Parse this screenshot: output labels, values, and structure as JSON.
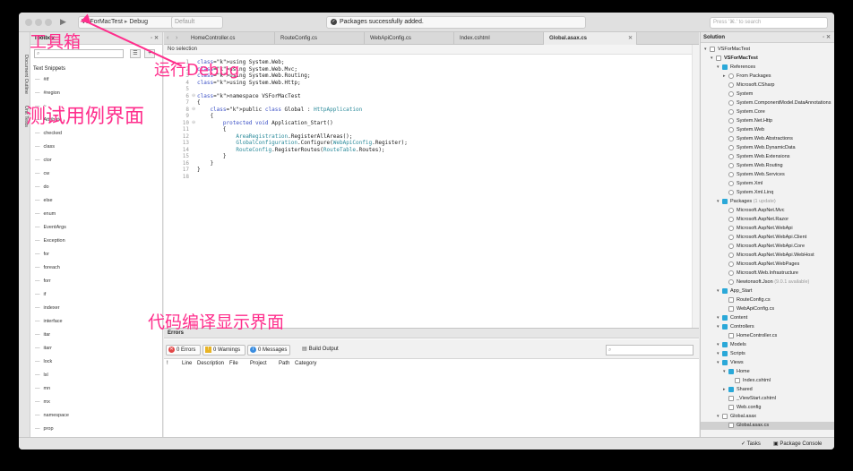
{
  "window": {
    "run_icon": "play-icon",
    "project_selector": "VSForMacTest",
    "config_selector": "Debug",
    "device_selector": "Default",
    "status": "Packages successfully added.",
    "search_placeholder": "Press '⌘.' to search"
  },
  "left_strip": {
    "items": [
      "Document Outline",
      "Unit Tests"
    ]
  },
  "toolbox": {
    "title": "Toolbox",
    "category": "Text Snippets",
    "snippets": [
      "#if",
      "#region",
      "~",
      "Attribute",
      "checked",
      "class",
      "ctor",
      "cw",
      "do",
      "else",
      "enum",
      "EventArgs",
      "Exception",
      "for",
      "foreach",
      "forr",
      "if",
      "indexer",
      "interface",
      "itar",
      "itarr",
      "lock",
      "lsl",
      "mn",
      "mx",
      "namespace",
      "prop"
    ]
  },
  "editor": {
    "tabs": [
      "HomeController.cs",
      "RouteConfig.cs",
      "WebApiConfig.cs",
      "Index.cshtml",
      "Global.asax.cs"
    ],
    "active_tab": "Global.asax.cs",
    "breadcrumb": "No selection",
    "code_lines": [
      "using System.Web;",
      "using System.Web.Mvc;",
      "using System.Web.Routing;",
      "using System.Web.Http;",
      "",
      "namespace VSForMacTest",
      "{",
      "    public class Global : HttpApplication",
      "    {",
      "        protected void Application_Start()",
      "        {",
      "            AreaRegistration.RegisterAllAreas();",
      "            GlobalConfiguration.Configure(WebApiConfig.Register);",
      "            RouteConfig.RegisterRoutes(RouteTable.Routes);",
      "        }",
      "    }",
      "}",
      ""
    ]
  },
  "errors": {
    "title": "Errors",
    "errors_label": "0 Errors",
    "warnings_label": "0 Warnings",
    "messages_label": "0 Messages",
    "build_output": "Build Output",
    "columns": [
      "!",
      "Line",
      "Description",
      "File",
      "Project",
      "Path",
      "Category"
    ]
  },
  "solution": {
    "title": "Solution",
    "nodes": [
      {
        "label": "VSForMacTest",
        "level": 0
      },
      {
        "label": "VSForMacTest",
        "level": 1,
        "bold": true
      },
      {
        "label": "References",
        "level": 2
      },
      {
        "label": "From Packages",
        "level": 3
      },
      {
        "label": "Microsoft.CSharp",
        "level": 3
      },
      {
        "label": "System",
        "level": 3
      },
      {
        "label": "System.ComponentModel.DataAnnotations",
        "level": 3
      },
      {
        "label": "System.Core",
        "level": 3
      },
      {
        "label": "System.Net.Http",
        "level": 3
      },
      {
        "label": "System.Web",
        "level": 3
      },
      {
        "label": "System.Web.Abstractions",
        "level": 3
      },
      {
        "label": "System.Web.DynamicData",
        "level": 3
      },
      {
        "label": "System.Web.Extensions",
        "level": 3
      },
      {
        "label": "System.Web.Routing",
        "level": 3
      },
      {
        "label": "System.Web.Services",
        "level": 3
      },
      {
        "label": "System.Xml",
        "level": 3
      },
      {
        "label": "System.Xml.Linq",
        "level": 3
      },
      {
        "label": "Packages",
        "level": 2,
        "note": "(1 update)"
      },
      {
        "label": "Microsoft.AspNet.Mvc",
        "level": 3
      },
      {
        "label": "Microsoft.AspNet.Razor",
        "level": 3
      },
      {
        "label": "Microsoft.AspNet.WebApi",
        "level": 3
      },
      {
        "label": "Microsoft.AspNet.WebApi.Client",
        "level": 3
      },
      {
        "label": "Microsoft.AspNet.WebApi.Core",
        "level": 3
      },
      {
        "label": "Microsoft.AspNet.WebApi.WebHost",
        "level": 3
      },
      {
        "label": "Microsoft.AspNet.WebPages",
        "level": 3
      },
      {
        "label": "Microsoft.Web.Infrastructure",
        "level": 3
      },
      {
        "label": "Newtonsoft.Json",
        "level": 3,
        "note": "(9.0.1 available)"
      },
      {
        "label": "App_Start",
        "level": 2
      },
      {
        "label": "RouteConfig.cs",
        "level": 3
      },
      {
        "label": "WebApiConfig.cs",
        "level": 3
      },
      {
        "label": "Content",
        "level": 2
      },
      {
        "label": "Controllers",
        "level": 2
      },
      {
        "label": "HomeController.cs",
        "level": 3
      },
      {
        "label": "Models",
        "level": 2
      },
      {
        "label": "Scripts",
        "level": 2
      },
      {
        "label": "Views",
        "level": 2
      },
      {
        "label": "Home",
        "level": 3
      },
      {
        "label": "Index.cshtml",
        "level": 4
      },
      {
        "label": "Shared",
        "level": 3
      },
      {
        "label": "_ViewStart.cshtml",
        "level": 3
      },
      {
        "label": "Web.config",
        "level": 3
      },
      {
        "label": "Global.asax",
        "level": 2
      },
      {
        "label": "Global.asax.cs",
        "level": 3,
        "selected": true
      }
    ]
  },
  "bottom": {
    "tasks": "Tasks",
    "package_console": "Package Console"
  },
  "annotations": {
    "toolbox": "工具箱",
    "run_debug": "运行Debug",
    "test_ui": "测试用例界面",
    "build_ui": "代码编译显示界面"
  },
  "colors": {
    "annotation": "#ff2e8c",
    "folder": "#2aa8d8",
    "keyword": "#3a4fc5",
    "type": "#2a8a9a"
  }
}
